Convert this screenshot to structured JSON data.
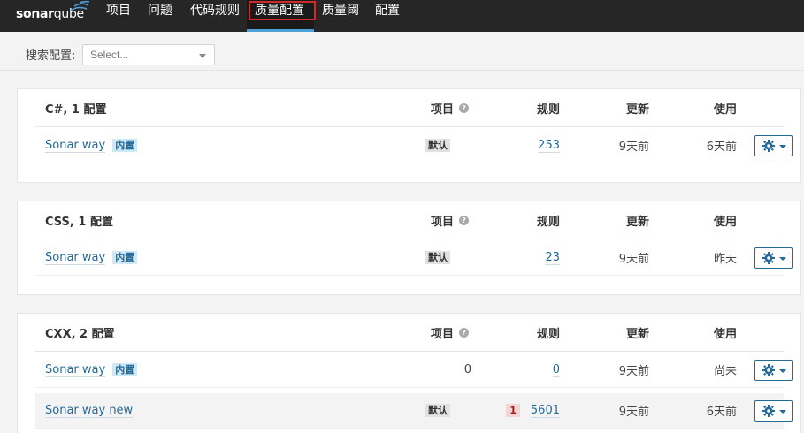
{
  "nav": {
    "logo_main": "sonar",
    "logo_sub": "qube",
    "items": [
      "项目",
      "问题",
      "代码规则",
      "质量配置",
      "质量阈",
      "配置"
    ]
  },
  "search": {
    "label": "搜索配置:",
    "placeholder": "Select..."
  },
  "columns": {
    "projects": "项目",
    "rules": "规则",
    "updated": "更新",
    "used": "使用"
  },
  "badges": {
    "builtin": "内置",
    "default": "默认"
  },
  "sections": [
    {
      "title": "C#, 1 配置",
      "profiles": [
        {
          "name": "Sonar way",
          "projects": "默认",
          "rules": "253",
          "updated": "9天前",
          "used": "6天前"
        }
      ]
    },
    {
      "title": "CSS, 1 配置",
      "profiles": [
        {
          "name": "Sonar way",
          "projects": "默认",
          "rules": "23",
          "updated": "9天前",
          "used": "昨天"
        }
      ]
    },
    {
      "title": "CXX, 2 配置",
      "profiles": [
        {
          "name": "Sonar way",
          "projects": "0",
          "rules": "0",
          "updated": "9天前",
          "used": "尚未"
        },
        {
          "name": "Sonar way new",
          "projects": "默认",
          "deprecated": "1",
          "rules": "5601",
          "updated": "9天前",
          "used": "6天前"
        }
      ]
    }
  ],
  "colors": {
    "nav_bg": "#262626",
    "link": "#236a97",
    "highlight_box": "#d02b2b"
  }
}
